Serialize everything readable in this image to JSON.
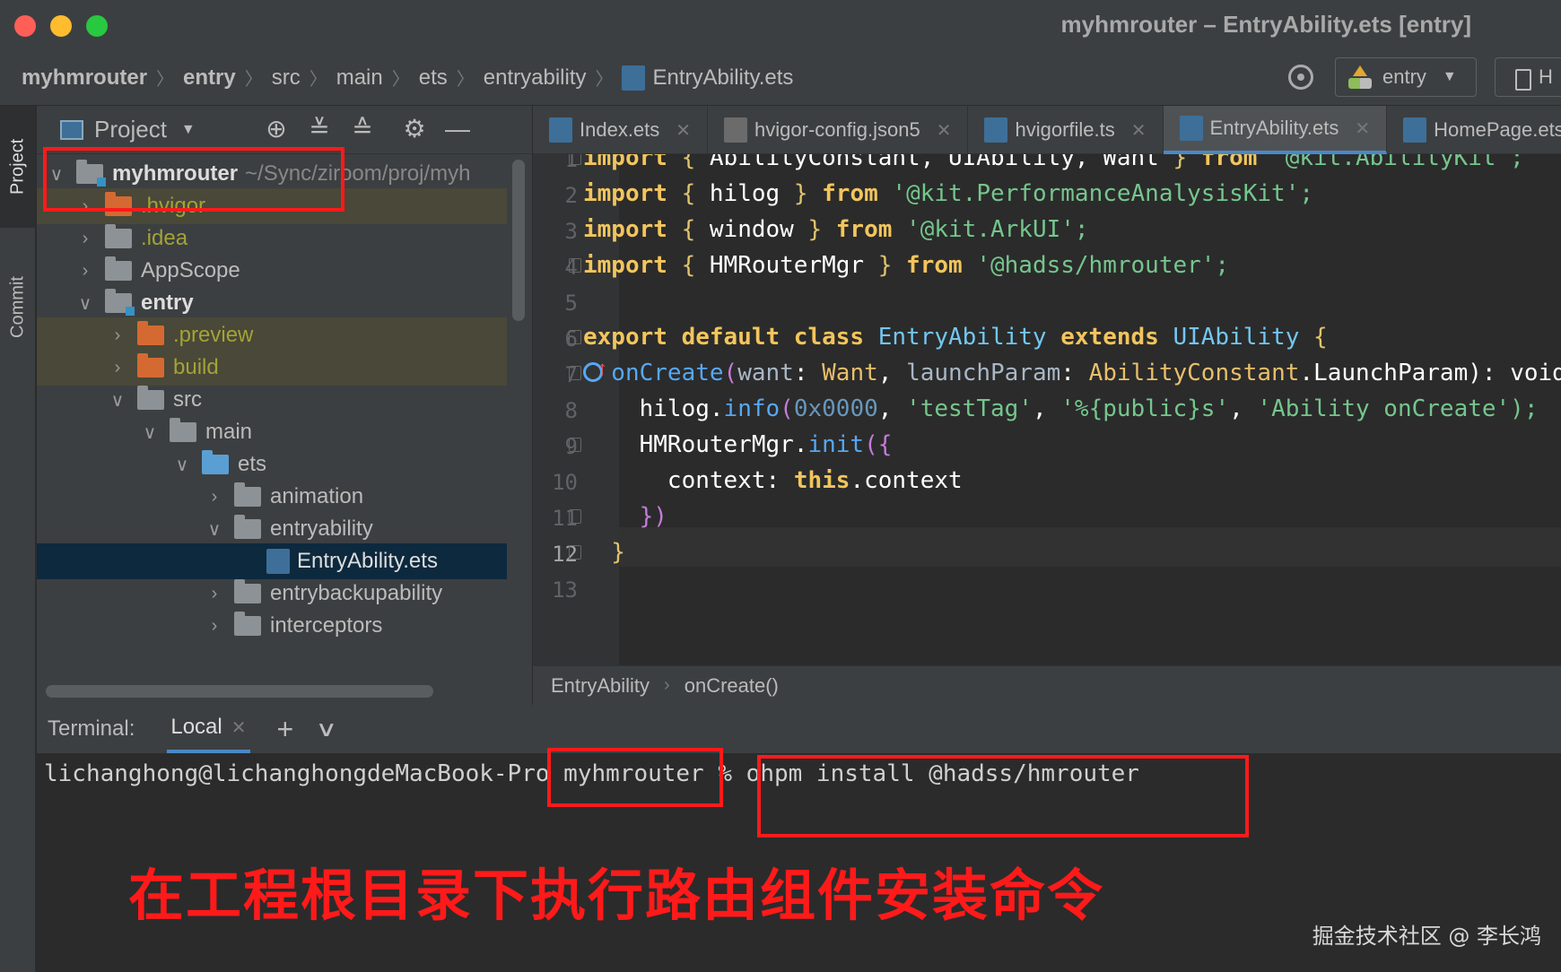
{
  "window": {
    "title": "myhmrouter – EntryAbility.ets [entry]"
  },
  "breadcrumbs": [
    "myhmrouter",
    "entry",
    "src",
    "main",
    "ets",
    "entryability",
    "EntryAbility.ets"
  ],
  "toolbar": {
    "run_config": "entry",
    "device_label": "H"
  },
  "stripe": {
    "project": "Project",
    "commit": "Commit"
  },
  "project_panel": {
    "title": "Project",
    "root_label": "myhmrouter",
    "root_path": "~/Sync/ziroom/proj/myh",
    "items": [
      {
        "label": ".hvigor"
      },
      {
        "label": ".idea"
      },
      {
        "label": "AppScope"
      },
      {
        "label": "entry"
      },
      {
        "label": ".preview"
      },
      {
        "label": "build"
      },
      {
        "label": "src"
      },
      {
        "label": "main"
      },
      {
        "label": "ets"
      },
      {
        "label": "animation"
      },
      {
        "label": "entryability"
      },
      {
        "label": "EntryAbility.ets"
      },
      {
        "label": "entrybackupability"
      },
      {
        "label": "interceptors"
      }
    ]
  },
  "tabs": [
    {
      "label": "Index.ets"
    },
    {
      "label": "hvigor-config.json5"
    },
    {
      "label": "hvigorfile.ts"
    },
    {
      "label": "EntryAbility.ets"
    },
    {
      "label": "HomePage.ets"
    }
  ],
  "editor": {
    "line_numbers": [
      "1",
      "2",
      "3",
      "4",
      "5",
      "6",
      "7",
      "8",
      "9",
      "10",
      "11",
      "12",
      "13"
    ],
    "current_line": 12,
    "code": {
      "l1_a": "import",
      "l1_b": " { ",
      "l1_c": "AbilityConstant, UIAbility, Want",
      "l1_d": " } ",
      "l1_e": "from",
      "l1_f": " '@kit.AbilityKit';",
      "l2_a": "import",
      "l2_b": " { ",
      "l2_c": "hilog",
      "l2_d": " } ",
      "l2_e": "from",
      "l2_f": " '@kit.PerformanceAnalysisKit';",
      "l3_a": "import",
      "l3_b": " { ",
      "l3_c": "window",
      "l3_d": " } ",
      "l3_e": "from",
      "l3_f": " '@kit.ArkUI';",
      "l4_a": "import",
      "l4_b": " { ",
      "l4_c": "HMRouterMgr",
      "l4_d": " } ",
      "l4_e": "from",
      "l4_f": " '@hadss/hmrouter';",
      "l6_a": "export default class",
      "l6_b": " EntryAbility ",
      "l6_c": "extends",
      "l6_d": " UIAbility ",
      "l6_e": "{",
      "l7_a": "  onCreate",
      "l7_b": "(",
      "l7_c": "want",
      "l7_d": ": ",
      "l7_e": "Want",
      "l7_f": ", ",
      "l7_g": "launchParam",
      "l7_h": ": ",
      "l7_i": "AbilityConstant",
      "l7_j": ".LaunchParam): void {",
      "l8_a": "    hilog.",
      "l8_b": "info",
      "l8_c": "(",
      "l8_d": "0x0000",
      "l8_e": ", ",
      "l8_f": "'testTag'",
      "l8_g": ", ",
      "l8_h": "'%{public}s'",
      "l8_i": ", ",
      "l8_j": "'Ability onCreate');",
      "l9_a": "    HMRouterMgr.",
      "l9_b": "init",
      "l9_c": "({",
      "l10_a": "      context: ",
      "l10_b": "this",
      "l10_c": ".context",
      "l11_a": "    })",
      "l12_a": "  }"
    }
  },
  "editor_breadcrumb": [
    "EntryAbility",
    "onCreate()"
  ],
  "terminal": {
    "label": "Terminal:",
    "tab": "Local",
    "prompt": "lichanghong@lichanghongdeMacBook-Pro myhmrouter % ohpm install @hadss/hmrouter"
  },
  "annotation": "在工程根目录下执行路由组件安装命令",
  "watermark": "掘金技术社区 @ 李长鸿",
  "colors": {
    "highlight": "#ff1a1a",
    "selection": "#0d293e",
    "accent": "#4a88c7"
  }
}
